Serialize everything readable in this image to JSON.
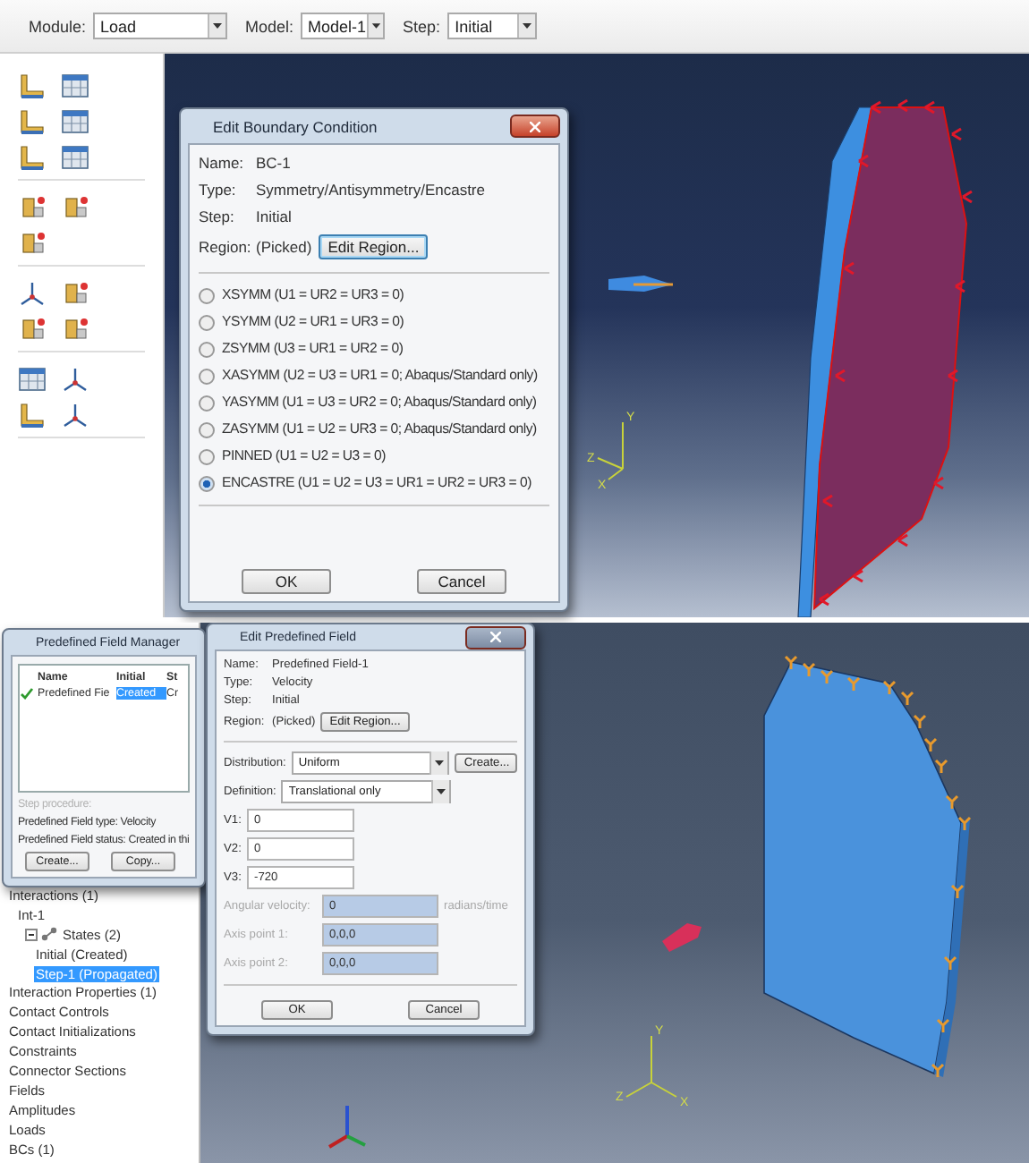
{
  "top": {
    "context_bar": [
      {
        "label": "Module:",
        "value": "Load"
      },
      {
        "label": "Model:",
        "value": "Model-1"
      },
      {
        "label": "Step:",
        "value": "Initial"
      }
    ],
    "viewport": {
      "triad_labels": [
        "Y",
        "Z",
        "X"
      ]
    },
    "bc_dialog": {
      "title": "Edit Boundary Condition",
      "info": [
        {
          "label": "Name:",
          "value": "BC-1"
        },
        {
          "label": "Type:",
          "value": "Symmetry/Antisymmetry/Encastre"
        },
        {
          "label": "Step:",
          "value": "Initial"
        }
      ],
      "region": {
        "label": "Region:",
        "value": "(Picked)",
        "button": "Edit Region..."
      },
      "options": [
        {
          "label": "XSYMM (U1 = UR2 = UR3 = 0)",
          "selected": false
        },
        {
          "label": "YSYMM (U2 = UR1 = UR3 = 0)",
          "selected": false
        },
        {
          "label": "ZSYMM (U3 = UR1 = UR2 = 0)",
          "selected": false
        },
        {
          "label": "XASYMM (U2 = U3 = UR1 = 0; Abaqus/Standard only)",
          "selected": false
        },
        {
          "label": "YASYMM (U1 = U3 = UR2 = 0; Abaqus/Standard only)",
          "selected": false
        },
        {
          "label": "ZASYMM (U1 = U2 = UR3 = 0; Abaqus/Standard only)",
          "selected": false
        },
        {
          "label": "PINNED (U1 = U2 = U3 = 0)",
          "selected": false
        },
        {
          "label": "ENCASTRE (U1 = U2 = U3 = UR1 = UR2 = UR3 = 0)",
          "selected": true
        }
      ],
      "buttons": [
        "OK",
        "Cancel"
      ]
    }
  },
  "bottom": {
    "tree": [
      {
        "label": "Interactions (1)",
        "selected": false,
        "children": [
          {
            "label": "Int-1",
            "selected": false,
            "children": [
              {
                "label": "States (2)",
                "selected": false,
                "expanded": true,
                "children": [
                  {
                    "label": "Initial (Created)",
                    "selected": false
                  },
                  {
                    "label": "Step-1 (Propagated)",
                    "selected": true
                  }
                ]
              }
            ]
          }
        ]
      },
      {
        "label": "Interaction Properties (1)",
        "selected": false
      },
      {
        "label": "Contact Controls",
        "selected": false
      },
      {
        "label": "Contact Initializations",
        "selected": false
      },
      {
        "label": "Constraints",
        "selected": false
      },
      {
        "label": "Connector Sections",
        "selected": false
      },
      {
        "label": "Fields",
        "selected": false
      },
      {
        "label": "Amplitudes",
        "selected": false
      },
      {
        "label": "Loads",
        "selected": false
      },
      {
        "label": "BCs (1)",
        "selected": false
      }
    ],
    "viewport": {
      "triad_labels": [
        "Y",
        "Z",
        "X"
      ]
    },
    "manager": {
      "title": "Predefined Field Manager",
      "columns": [
        "Name",
        "Initial",
        "St"
      ],
      "rows": [
        {
          "checked": true,
          "cells": [
            {
              "text": "Predefined Fie",
              "selected": false
            },
            {
              "text": "Created",
              "selected": true
            },
            {
              "text": "Cr",
              "selected": false
            }
          ]
        }
      ],
      "lines": [
        {
          "text": "Step procedure:",
          "disabled": true
        },
        {
          "text": "Predefined Field type:  Velocity",
          "disabled": false
        },
        {
          "text": "Predefined Field status: Created in thi",
          "disabled": false
        }
      ],
      "buttons": [
        "Create...",
        "Copy..."
      ]
    },
    "field_dialog": {
      "title": "Edit Predefined Field",
      "info": [
        {
          "label": "Name:",
          "value": "Predefined Field-1"
        },
        {
          "label": "Type:",
          "value": "Velocity"
        },
        {
          "label": "Step:",
          "value": "Initial"
        }
      ],
      "region": {
        "label": "Region:",
        "value": "(Picked)",
        "button": "Edit Region..."
      },
      "distribution": {
        "label": "Distribution:",
        "value": "Uniform",
        "button": "Create..."
      },
      "definition": {
        "label": "Definition:",
        "value": "Translational only"
      },
      "components": [
        {
          "label": "V1:",
          "value": "0"
        },
        {
          "label": "V2:",
          "value": "0"
        },
        {
          "label": "V3:",
          "value": "-720"
        }
      ],
      "rotation": [
        {
          "label": "Angular velocity:",
          "value": "0",
          "unit": "radians/time",
          "disabled": true
        },
        {
          "label": "Axis point 1:",
          "value": "0,0,0",
          "disabled": true
        },
        {
          "label": "Axis point 2:",
          "value": "0,0,0",
          "disabled": true
        }
      ],
      "buttons": [
        "OK",
        "Cancel"
      ]
    }
  }
}
